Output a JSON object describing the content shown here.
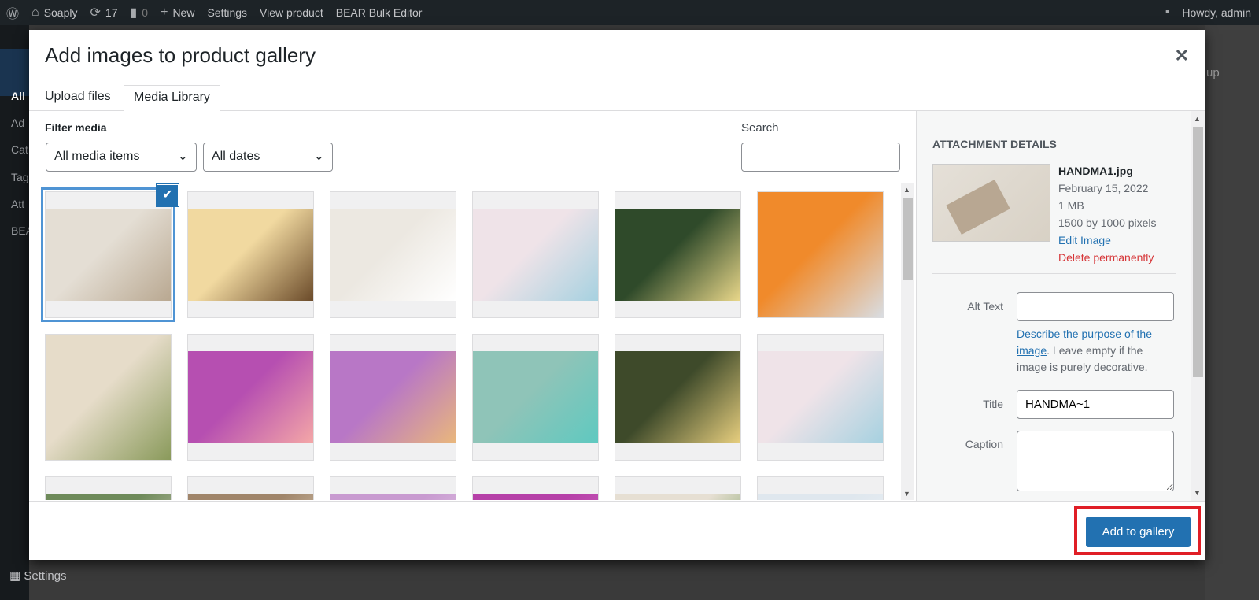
{
  "adminbar": {
    "site": "Soaply",
    "updates": "17",
    "comments": "0",
    "new": "New",
    "settings": "Settings",
    "view_product": "View product",
    "bear": "BEAR Bulk Editor",
    "howdy": "Howdy, admin"
  },
  "sidebar": {
    "items": [
      "All",
      "Ad",
      "Cat",
      "Tag",
      "Att",
      "BEA"
    ],
    "settings": "Settings"
  },
  "background": {
    "right_text": "up"
  },
  "modal": {
    "title": "Add images to product gallery",
    "tabs": [
      {
        "label": "Upload files",
        "active": false
      },
      {
        "label": "Media Library",
        "active": true
      }
    ],
    "filter_label": "Filter media",
    "type_filter": "All media items",
    "date_filter": "All dates",
    "search_label": "Search",
    "search_value": "",
    "thumbnails": [
      {
        "colors": [
          "#e4ded4",
          "#b9a891"
        ],
        "selected": true
      },
      {
        "colors": [
          "#f1d9a0",
          "#6b4b2a"
        ]
      },
      {
        "colors": [
          "#ece8e1",
          "#ffffff"
        ]
      },
      {
        "colors": [
          "#efe3e8",
          "#a6d1e0"
        ]
      },
      {
        "colors": [
          "#2f4a2a",
          "#e9d78a"
        ]
      },
      {
        "colors": [
          "#f08a2b",
          "#d9dde2"
        ]
      },
      {
        "colors": [
          "#e6dcc9",
          "#8a9a5b"
        ]
      },
      {
        "colors": [
          "#b64fb1",
          "#f4a7a7"
        ]
      },
      {
        "colors": [
          "#b877c6",
          "#e9b77c"
        ]
      },
      {
        "colors": [
          "#8fc4b8",
          "#5fc9c0"
        ]
      },
      {
        "colors": [
          "#3e4a2a",
          "#e8cf7f"
        ]
      },
      {
        "colors": [
          "#efe3e8",
          "#a6d1e0"
        ]
      },
      {
        "colors": [
          "#6e8a5a",
          "#dcd3c4"
        ]
      },
      {
        "colors": [
          "#a0856a",
          "#e8dcc7"
        ]
      },
      {
        "colors": [
          "#c89ad0",
          "#e8d1ea"
        ]
      },
      {
        "colors": [
          "#b640a8",
          "#d46cc5"
        ]
      },
      {
        "colors": [
          "#e6dfd3",
          "#5b8a3c"
        ]
      },
      {
        "colors": [
          "#dfe7ee",
          "#eef2f5"
        ]
      }
    ],
    "details": {
      "heading": "Attachment Details",
      "filename": "HANDMA1.jpg",
      "date": "February 15, 2022",
      "size": "1 MB",
      "dimensions": "1500 by 1000 pixels",
      "edit": "Edit Image",
      "delete": "Delete permanently",
      "alt_label": "Alt Text",
      "alt_value": "",
      "alt_help_link": "Describe the purpose of the image",
      "alt_help_rest": ". Leave empty if the image is purely decorative.",
      "title_label": "Title",
      "title_value": "HANDMA~1",
      "caption_label": "Caption",
      "caption_value": ""
    },
    "add_button": "Add to gallery",
    "highlight_color": "#e01e26",
    "accent": "#2271b1"
  }
}
